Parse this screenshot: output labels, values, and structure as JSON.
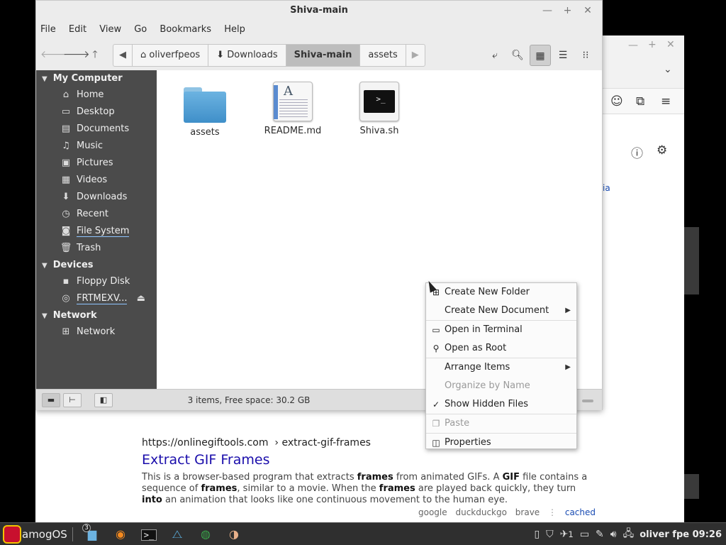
{
  "browser": {
    "crumb_partial": "ia",
    "result": {
      "url_domain": "https://onlinegiftools.com",
      "url_path": "› extract-gif-frames",
      "title": "Extract GIF Frames",
      "snippet_parts": [
        {
          "t": "This is a browser-based program that extracts ",
          "b": false
        },
        {
          "t": "frames",
          "b": true
        },
        {
          "t": " from animated GIFs. A ",
          "b": false
        },
        {
          "t": "GIF",
          "b": true
        },
        {
          "t": " file contains a sequence of ",
          "b": false
        },
        {
          "t": "frames",
          "b": true
        },
        {
          "t": ", similar to a movie. When the ",
          "b": false
        },
        {
          "t": "frames",
          "b": true
        },
        {
          "t": " are played back quickly, they turn ",
          "b": false
        },
        {
          "t": "into",
          "b": true
        },
        {
          "t": " an animation that looks like one continuous movement to the human eye.",
          "b": false
        }
      ],
      "engines": [
        "google",
        "duckduckgo",
        "brave"
      ],
      "cached": "cached"
    }
  },
  "fm": {
    "title": "Shiva-main",
    "menu": [
      "File",
      "Edit",
      "View",
      "Go",
      "Bookmarks",
      "Help"
    ],
    "path": [
      "oliverfpeos",
      "Downloads",
      "Shiva-main",
      "assets"
    ],
    "sidebar": {
      "my_computer": "My Computer",
      "places": [
        "Home",
        "Desktop",
        "Documents",
        "Music",
        "Pictures",
        "Videos",
        "Downloads",
        "Recent",
        "File System",
        "Trash"
      ],
      "devices_hdr": "Devices",
      "devices": [
        "Floppy Disk",
        "FRTMEXV..."
      ],
      "network_hdr": "Network",
      "network": [
        "Network"
      ]
    },
    "files": [
      "assets",
      "README.md",
      "Shiva.sh"
    ],
    "status": "3 items, Free space: 30.2 GB"
  },
  "context_menu": {
    "items": [
      "Create New Folder",
      "Create New Document",
      "Open in Terminal",
      "Open as Root",
      "Arrange Items",
      "Organize by Name",
      "Show Hidden Files",
      "Paste",
      "Properties"
    ]
  },
  "taskbar": {
    "start_label": "amogOS",
    "files_badge": "3",
    "tray_text_1": "1",
    "clock": "oliver fpe 09:26"
  }
}
